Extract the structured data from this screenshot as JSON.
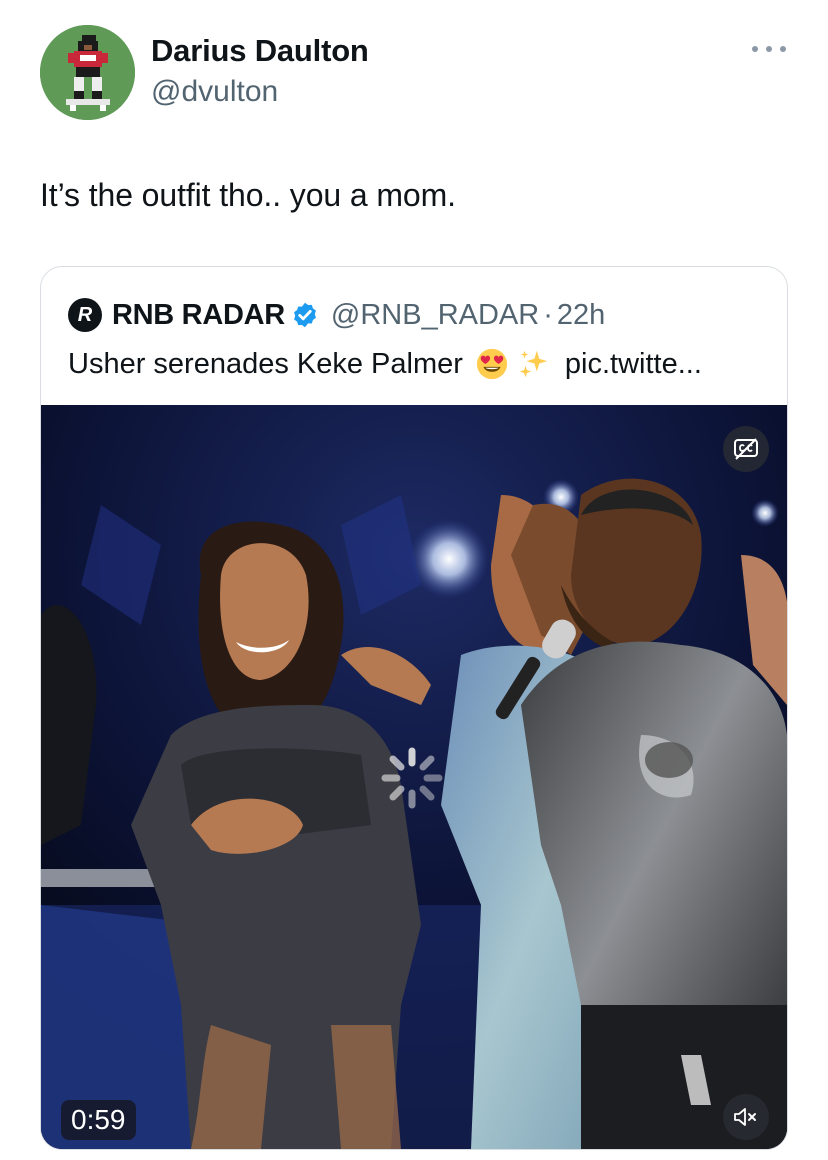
{
  "author": {
    "display_name": "Darius Daulton",
    "handle": "@dvulton",
    "avatar_icon": "pixel-football-player-avatar"
  },
  "tweet": {
    "text": "It’s the outfit tho.. you a mom."
  },
  "quoted_tweet": {
    "display_name": "RNB RADAR",
    "verified": true,
    "handle": "@RNB_RADAR",
    "separator": "·",
    "time": "22h",
    "text": "Usher serenades Keke Palmer",
    "emojis": [
      "heart-eyes-emoji",
      "sparkles-emoji"
    ],
    "link_text": "pic.twitte..."
  },
  "video": {
    "duration": "0:59",
    "cc_icon": "closed-captions-icon",
    "mute_icon": "muted-speaker-icon",
    "loading_icon": "loading-spinner-icon"
  },
  "colors": {
    "text_primary": "#0f1419",
    "text_secondary": "#536471",
    "verified_blue": "#1d9bf0",
    "border": "#d9dde1"
  }
}
